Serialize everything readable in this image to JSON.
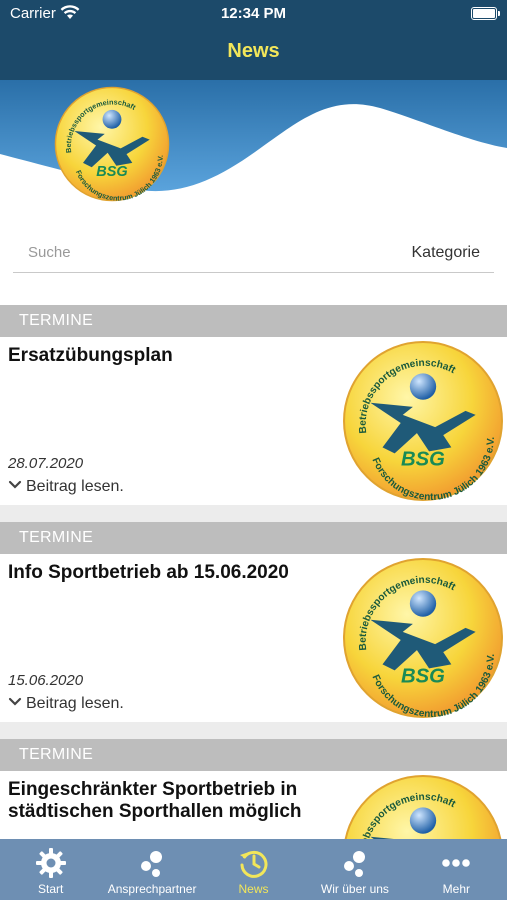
{
  "status": {
    "carrier": "Carrier",
    "time": "12:34 PM"
  },
  "nav": {
    "title": "News"
  },
  "search": {
    "placeholder": "Suche",
    "category_label": "Kategorie"
  },
  "logo": {
    "arc_top": "Betriebssportgemeinschaft",
    "arc_bottom": "Forschungszentrum Jülich 1963 e.V.",
    "initials": "BSG"
  },
  "articles": [
    {
      "category": "TERMINE",
      "title": "Ersatzübungsplan",
      "date": "28.07.2020",
      "read_more": "Beitrag lesen."
    },
    {
      "category": "TERMINE",
      "title": "Info Sportbetrieb ab 15.06.2020",
      "date": "15.06.2020",
      "read_more": "Beitrag lesen."
    },
    {
      "category": "TERMINE",
      "title": "Eingeschränkter Sportbetrieb in städtischen Sporthallen möglich",
      "date": "",
      "read_more": ""
    }
  ],
  "tabs": [
    {
      "label": "Start",
      "icon": "gear-icon"
    },
    {
      "label": "Ansprechpartner",
      "icon": "people-icon"
    },
    {
      "label": "News",
      "icon": "history-clock-icon"
    },
    {
      "label": "Wir über uns",
      "icon": "people-icon"
    },
    {
      "label": "Mehr",
      "icon": "more-dots-icon"
    }
  ],
  "colors": {
    "nav_bg": "#1c4a6a",
    "nav_title": "#f2e65a",
    "tabbar_bg": "#6e8fb3",
    "tab_active": "#f2e65a",
    "category_bar": "#bdbdbd"
  }
}
